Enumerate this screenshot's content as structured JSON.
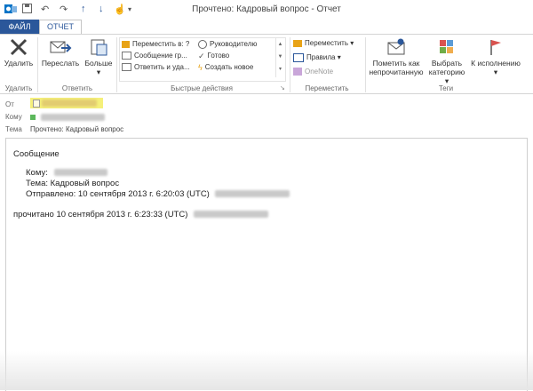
{
  "window": {
    "title": "Прочтено: Кадровый вопрос - Отчет"
  },
  "tabs": {
    "file": "ФАЙЛ",
    "report": "ОТЧЕТ"
  },
  "ribbon": {
    "delete": {
      "label": "Удалить",
      "group": "Удалить"
    },
    "respond": {
      "forward": "Переслать",
      "more": "Больше",
      "group": "Ответить"
    },
    "quick_steps": {
      "items": [
        "Переместить в: ?",
        "Сообщение гр...",
        "Ответить и уда...",
        "Руководителю",
        "Готово",
        "Создать новое"
      ],
      "group": "Быстрые действия"
    },
    "move": {
      "move": "Переместить",
      "rules": "Правила",
      "onenote": "OneNote",
      "group": "Переместить"
    },
    "tags": {
      "mark_unread": "Пометить как непрочитанную",
      "categorize": "Выбрать категорию",
      "follow_up": "К исполнению",
      "group": "Теги"
    }
  },
  "header": {
    "from_label": "От",
    "to_label": "Кому",
    "subject_label": "Тема",
    "subject": "Прочтено: Кадровый вопрос"
  },
  "message": {
    "heading": "Сообщение",
    "to_label": "Кому:",
    "subject_line": "Тема: Кадровый вопрос",
    "sent_line": "Отправлено: 10 сентября 2013 г. 6:20:03 (UTC)",
    "read_line": "прочитано 10 сентября 2013 г. 6:23:33 (UTC)"
  },
  "colors": {
    "accent": "#2b579a",
    "from_highlight": "#f5f07a",
    "presence": "#5cb85c"
  }
}
